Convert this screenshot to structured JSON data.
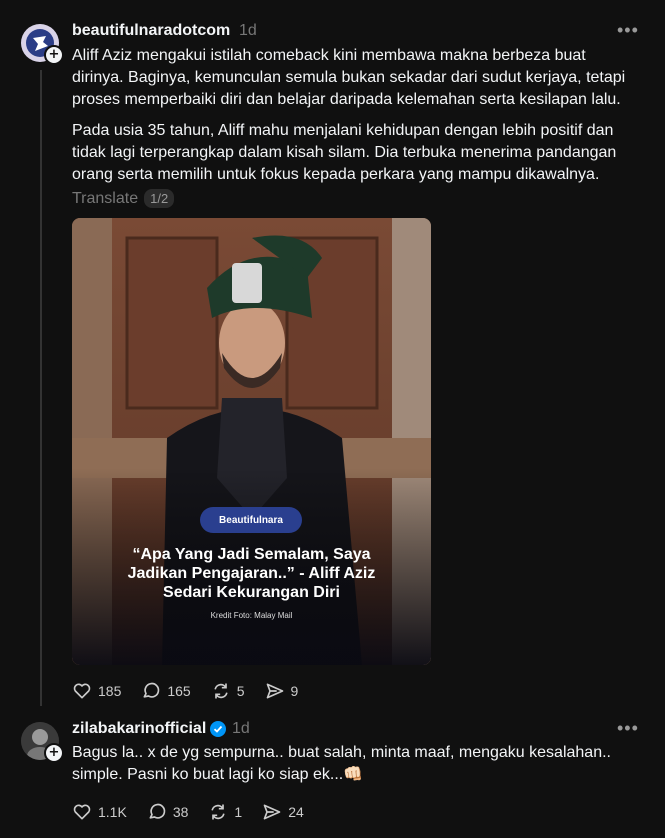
{
  "post1": {
    "username": "beautifulnaradotcom",
    "time": "1d",
    "para1_l1": "Aliff Aziz mengakui istilah comeback kini membawa makna berbeza buat",
    "para1_l2": "dirinya. Baginya, kemunculan semula bukan sekadar dari sudut kerjaya, tetapi",
    "para1_l3": "proses memperbaiki diri dan belajar daripada kelemahan serta kesilapan lalu.",
    "para2_l1": "Pada usia 35 tahun, Aliff mahu menjalani kehidupan dengan lebih positif dan",
    "para2_l2": "tidak lagi terperangkap dalam kisah silam. Dia terbuka menerima pandangan",
    "para2_l3": "orang serta memilih untuk fokus kepada perkara yang mampu dikawalnya.",
    "translate": "Translate",
    "page_badge": "1/2",
    "image": {
      "logo_text": "Beautifulnara",
      "caption_l1": "“Apa Yang Jadi Semalam, Saya",
      "caption_l2": "Jadikan Pengajaran..” - Aliff Aziz",
      "caption_l3": "Sedari Kekurangan Diri",
      "credit": "Kredit Foto: Malay Mail"
    },
    "likes": "185",
    "comments": "165",
    "reposts": "5",
    "shares": "9"
  },
  "post2": {
    "username": "zilabakarinofficial",
    "time": "1d",
    "line1": "Bagus la.. x de yg sempurna.. buat salah, minta maaf, mengaku kesalahan..",
    "line2": "simple. Pasni ko buat lagi ko siap ek...👊🏻",
    "likes": "1.1K",
    "comments": "38",
    "reposts": "1",
    "shares": "24"
  },
  "colors": {
    "background": "#101010",
    "text": "#f3f5f7",
    "muted": "#777777",
    "verified": "#0095f6"
  }
}
